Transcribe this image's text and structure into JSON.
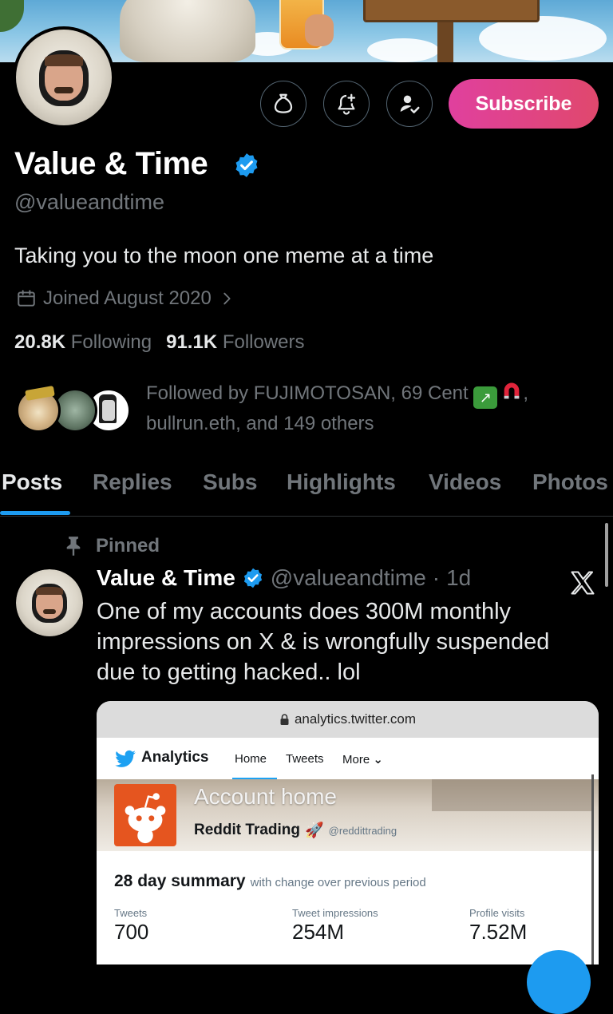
{
  "profile": {
    "name": "Value & Time",
    "handle": "@valueandtime",
    "bio": "Taking you to the moon one meme at a time",
    "joined": "Joined August 2020",
    "following_count": "20.8K",
    "following_label": "Following",
    "followers_count": "91.1K",
    "followers_label": "Followers",
    "verified": true
  },
  "actions": {
    "subscribe_label": "Subscribe",
    "icons": [
      "money-bag-icon",
      "bell-icon",
      "follow-person-icon"
    ]
  },
  "followed_by": {
    "line1": "Followed by FUJIMOTOSAN, 69 Cent",
    "line1_tail": ",",
    "line2": "bullrun.eth, and 149 others",
    "emojis": [
      "chart-yen-emoji",
      "magnet-emoji"
    ]
  },
  "tabs": [
    {
      "label": "Posts",
      "active": true
    },
    {
      "label": "Replies",
      "active": false
    },
    {
      "label": "Subs",
      "active": false
    },
    {
      "label": "Highlights",
      "active": false
    },
    {
      "label": "Videos",
      "active": false
    },
    {
      "label": "Photos",
      "active": false
    }
  ],
  "post": {
    "pinned_label": "Pinned",
    "author_name": "Value & Time",
    "author_handle": "@valueandtime",
    "separator": "·",
    "time": "1d",
    "text": "One of my accounts does 300M monthly impressions on X & is wrongfully suspended due to getting hacked.. lol"
  },
  "embed": {
    "url": "analytics.twitter.com",
    "app_title": "Analytics",
    "nav_tabs": [
      "Home",
      "Tweets",
      "More"
    ],
    "hero_title": "Account home",
    "account_name": "Reddit Trading",
    "account_handle": "@reddittrading",
    "summary_title": "28 day summary",
    "summary_sub": "with change over previous period",
    "metrics": [
      {
        "label": "Tweets",
        "value": "700"
      },
      {
        "label": "Tweet impressions",
        "value": "254M"
      },
      {
        "label": "Profile visits",
        "value": "7.52M"
      }
    ]
  },
  "colors": {
    "accent_blue": "#1d9bf0",
    "subscribe_pink": "#e0409e",
    "muted_text": "#71767b",
    "background": "#000000"
  }
}
